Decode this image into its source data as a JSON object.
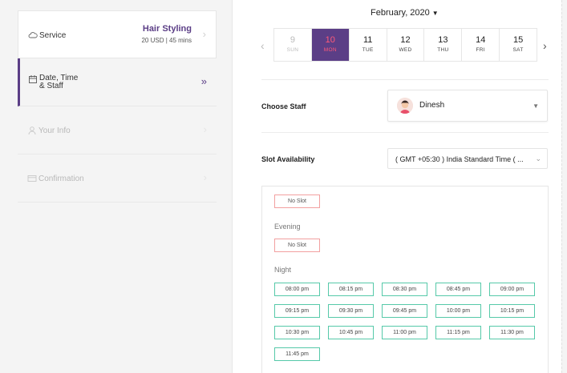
{
  "steps": [
    {
      "label": "Service",
      "icon": "cloud-icon",
      "service_name": "Hair Styling",
      "service_meta": "20 USD | 45 mins"
    },
    {
      "label_line1": "Date, Time",
      "label_line2": "& Staff",
      "icon": "calendar-icon"
    },
    {
      "label": "Your Info",
      "icon": "user-icon"
    },
    {
      "label": "Confirmation",
      "icon": "card-icon"
    }
  ],
  "calendar": {
    "month_label": "February, 2020",
    "days": [
      {
        "num": "9",
        "name": "SUN",
        "state": "disabled"
      },
      {
        "num": "10",
        "name": "MON",
        "state": "selected"
      },
      {
        "num": "11",
        "name": "TUE",
        "state": "normal"
      },
      {
        "num": "12",
        "name": "WED",
        "state": "normal"
      },
      {
        "num": "13",
        "name": "THU",
        "state": "normal"
      },
      {
        "num": "14",
        "name": "FRI",
        "state": "normal"
      },
      {
        "num": "15",
        "name": "SAT",
        "state": "normal"
      }
    ]
  },
  "staff": {
    "label": "Choose Staff",
    "selected": "Dinesh"
  },
  "timezone": {
    "label": "Slot Availability",
    "value": "( GMT +05:30 ) India Standard Time ( ..."
  },
  "slots": {
    "no_slot_label": "No Slot",
    "evening_heading": "Evening",
    "night_heading": "Night",
    "night_slots": [
      "08:00 pm",
      "08:15 pm",
      "08:30 pm",
      "08:45 pm",
      "09:00 pm",
      "09:15 pm",
      "09:30 pm",
      "09:45 pm",
      "10:00 pm",
      "10:15 pm",
      "10:30 pm",
      "10:45 pm",
      "11:00 pm",
      "11:15 pm",
      "11:30 pm",
      "11:45 pm"
    ]
  },
  "colors": {
    "accent": "#5b3e86",
    "selected_text": "#ff5a7a",
    "slot_border": "#56c9a9",
    "noslot_border": "#f2a0a0"
  }
}
